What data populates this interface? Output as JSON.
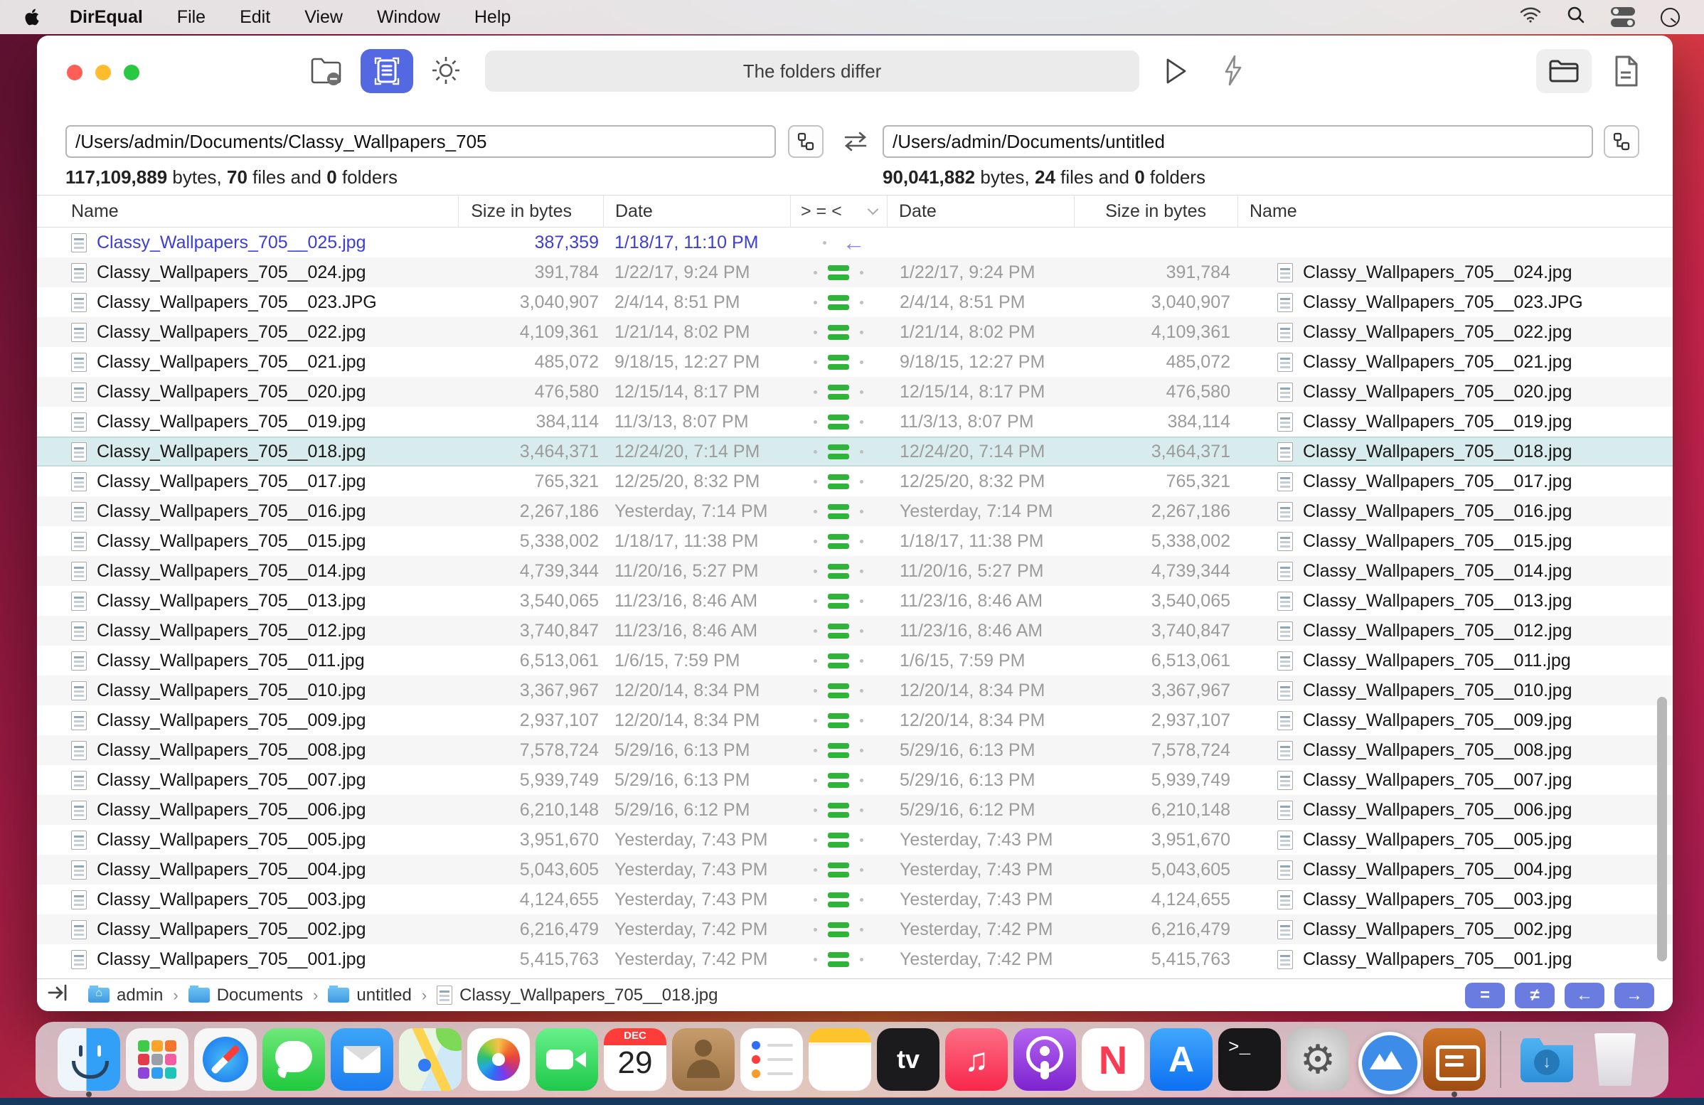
{
  "menu_bar": {
    "app_name": "DirEqual",
    "items": [
      "File",
      "Edit",
      "View",
      "Window",
      "Help"
    ]
  },
  "toolbar": {
    "status_text": "The folders differ"
  },
  "left_pane": {
    "path": "/Users/admin/Documents/Classy_Wallpapers_705",
    "bytes": "117,109,889",
    "files": "70",
    "folders": "0"
  },
  "right_pane": {
    "path": "/Users/admin/Documents/untitled",
    "bytes": "90,041,882",
    "files": "24",
    "folders": "0"
  },
  "labels": {
    "bytes": "bytes,",
    "files": "files and",
    "folders": "folders"
  },
  "table": {
    "headers": {
      "name": "Name",
      "size": "Size in bytes",
      "date": "Date",
      "comparison": "> = <"
    },
    "rows": [
      {
        "name": "Classy_Wallpapers_705__025.jpg",
        "size": "387,359",
        "date": "1/18/17, 11:10 PM",
        "status": "left-only",
        "selected": false
      },
      {
        "name": "Classy_Wallpapers_705__024.jpg",
        "size": "391,784",
        "date": "1/22/17, 9:24 PM",
        "status": "equal",
        "selected": false
      },
      {
        "name": "Classy_Wallpapers_705__023.JPG",
        "size": "3,040,907",
        "date": "2/4/14, 8:51 PM",
        "status": "equal",
        "selected": false
      },
      {
        "name": "Classy_Wallpapers_705__022.jpg",
        "size": "4,109,361",
        "date": "1/21/14, 8:02 PM",
        "status": "equal",
        "selected": false
      },
      {
        "name": "Classy_Wallpapers_705__021.jpg",
        "size": "485,072",
        "date": "9/18/15, 12:27 PM",
        "status": "equal",
        "selected": false
      },
      {
        "name": "Classy_Wallpapers_705__020.jpg",
        "size": "476,580",
        "date": "12/15/14, 8:17 PM",
        "status": "equal",
        "selected": false
      },
      {
        "name": "Classy_Wallpapers_705__019.jpg",
        "size": "384,114",
        "date": "11/3/13, 8:07 PM",
        "status": "equal",
        "selected": false
      },
      {
        "name": "Classy_Wallpapers_705__018.jpg",
        "size": "3,464,371",
        "date": "12/24/20, 7:14 PM",
        "status": "equal",
        "selected": true
      },
      {
        "name": "Classy_Wallpapers_705__017.jpg",
        "size": "765,321",
        "date": "12/25/20, 8:32 PM",
        "status": "equal",
        "selected": false
      },
      {
        "name": "Classy_Wallpapers_705__016.jpg",
        "size": "2,267,186",
        "date": "Yesterday, 7:14 PM",
        "status": "equal",
        "selected": false
      },
      {
        "name": "Classy_Wallpapers_705__015.jpg",
        "size": "5,338,002",
        "date": "1/18/17, 11:38 PM",
        "status": "equal",
        "selected": false
      },
      {
        "name": "Classy_Wallpapers_705__014.jpg",
        "size": "4,739,344",
        "date": "11/20/16, 5:27 PM",
        "status": "equal",
        "selected": false
      },
      {
        "name": "Classy_Wallpapers_705__013.jpg",
        "size": "3,540,065",
        "date": "11/23/16, 8:46 AM",
        "status": "equal",
        "selected": false
      },
      {
        "name": "Classy_Wallpapers_705__012.jpg",
        "size": "3,740,847",
        "date": "11/23/16, 8:46 AM",
        "status": "equal",
        "selected": false
      },
      {
        "name": "Classy_Wallpapers_705__011.jpg",
        "size": "6,513,061",
        "date": "1/6/15, 7:59 PM",
        "status": "equal",
        "selected": false
      },
      {
        "name": "Classy_Wallpapers_705__010.jpg",
        "size": "3,367,967",
        "date": "12/20/14, 8:34 PM",
        "status": "equal",
        "selected": false
      },
      {
        "name": "Classy_Wallpapers_705__009.jpg",
        "size": "2,937,107",
        "date": "12/20/14, 8:34 PM",
        "status": "equal",
        "selected": false
      },
      {
        "name": "Classy_Wallpapers_705__008.jpg",
        "size": "7,578,724",
        "date": "5/29/16, 6:13 PM",
        "status": "equal",
        "selected": false
      },
      {
        "name": "Classy_Wallpapers_705__007.jpg",
        "size": "5,939,749",
        "date": "5/29/16, 6:13 PM",
        "status": "equal",
        "selected": false
      },
      {
        "name": "Classy_Wallpapers_705__006.jpg",
        "size": "6,210,148",
        "date": "5/29/16, 6:12 PM",
        "status": "equal",
        "selected": false
      },
      {
        "name": "Classy_Wallpapers_705__005.jpg",
        "size": "3,951,670",
        "date": "Yesterday, 7:43 PM",
        "status": "equal",
        "selected": false
      },
      {
        "name": "Classy_Wallpapers_705__004.jpg",
        "size": "5,043,605",
        "date": "Yesterday, 7:43 PM",
        "status": "equal",
        "selected": false
      },
      {
        "name": "Classy_Wallpapers_705__003.jpg",
        "size": "4,124,655",
        "date": "Yesterday, 7:43 PM",
        "status": "equal",
        "selected": false
      },
      {
        "name": "Classy_Wallpapers_705__002.jpg",
        "size": "6,216,479",
        "date": "Yesterday, 7:42 PM",
        "status": "equal",
        "selected": false
      },
      {
        "name": "Classy_Wallpapers_705__001.jpg",
        "size": "5,415,763",
        "date": "Yesterday, 7:42 PM",
        "status": "equal",
        "selected": false
      }
    ]
  },
  "pathbar": {
    "breadcrumbs": [
      {
        "icon": "home-folder",
        "label": "admin"
      },
      {
        "icon": "folder",
        "label": "Documents"
      },
      {
        "icon": "folder",
        "label": "untitled"
      },
      {
        "icon": "file",
        "label": "Classy_Wallpapers_705__018.jpg"
      }
    ],
    "separator": "›",
    "buttons": [
      {
        "name": "filter-equal",
        "glyph": "="
      },
      {
        "name": "filter-not-equal",
        "glyph": "≠"
      },
      {
        "name": "filter-left-only",
        "glyph": "←"
      },
      {
        "name": "filter-right-only",
        "glyph": "→"
      }
    ]
  },
  "dock": {
    "items": [
      {
        "name": "finder",
        "label": "Finder",
        "running": true
      },
      {
        "name": "launchpad",
        "label": "Launchpad"
      },
      {
        "name": "safari",
        "label": "Safari"
      },
      {
        "name": "messages",
        "label": "Messages"
      },
      {
        "name": "mail",
        "label": "Mail"
      },
      {
        "name": "maps",
        "label": "Maps"
      },
      {
        "name": "photos",
        "label": "Photos"
      },
      {
        "name": "facetime",
        "label": "FaceTime"
      },
      {
        "name": "calendar",
        "label": "Calendar",
        "month": "DEC",
        "day": "29"
      },
      {
        "name": "contacts",
        "label": "Contacts"
      },
      {
        "name": "reminders",
        "label": "Reminders"
      },
      {
        "name": "notes",
        "label": "Notes"
      },
      {
        "name": "tv",
        "label": "Apple TV",
        "glyph": "tv"
      },
      {
        "name": "music",
        "label": "Music",
        "glyph": "♫"
      },
      {
        "name": "podcasts",
        "label": "Podcasts"
      },
      {
        "name": "news",
        "label": "News",
        "glyph": "N"
      },
      {
        "name": "appstore",
        "label": "App Store",
        "glyph": "A"
      },
      {
        "name": "terminal",
        "label": "Terminal",
        "glyph": ">_"
      },
      {
        "name": "sysprefs",
        "label": "System Preferences",
        "glyph": "⚙"
      },
      {
        "name": "mountain",
        "label": "Image App"
      },
      {
        "name": "direqual",
        "label": "DirEqual",
        "running": true
      },
      {
        "name": "separator"
      },
      {
        "name": "downloads",
        "label": "Downloads"
      },
      {
        "name": "trash",
        "label": "Trash"
      }
    ]
  },
  "colors": {
    "accent_blue": "#5468e2",
    "equal_green": "#2fb43a",
    "left_only_blue": "#3c3ed4",
    "left_arrow": "#8487ee",
    "selected_row_bg": "#d9eced"
  }
}
